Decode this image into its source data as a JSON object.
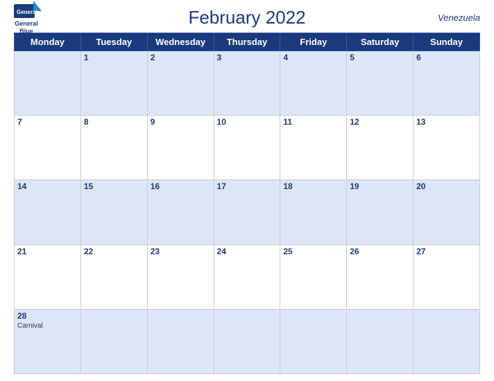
{
  "header": {
    "logo_line1": "General",
    "logo_line2": "Blue",
    "title": "February 2022",
    "country": "Venezuela"
  },
  "days_of_week": [
    "Monday",
    "Tuesday",
    "Wednesday",
    "Thursday",
    "Friday",
    "Saturday",
    "Sunday"
  ],
  "weeks": [
    [
      {
        "num": "",
        "event": ""
      },
      {
        "num": "1",
        "event": ""
      },
      {
        "num": "2",
        "event": ""
      },
      {
        "num": "3",
        "event": ""
      },
      {
        "num": "4",
        "event": ""
      },
      {
        "num": "5",
        "event": ""
      },
      {
        "num": "6",
        "event": ""
      }
    ],
    [
      {
        "num": "7",
        "event": ""
      },
      {
        "num": "8",
        "event": ""
      },
      {
        "num": "9",
        "event": ""
      },
      {
        "num": "10",
        "event": ""
      },
      {
        "num": "11",
        "event": ""
      },
      {
        "num": "12",
        "event": ""
      },
      {
        "num": "13",
        "event": ""
      }
    ],
    [
      {
        "num": "14",
        "event": ""
      },
      {
        "num": "15",
        "event": ""
      },
      {
        "num": "16",
        "event": ""
      },
      {
        "num": "17",
        "event": ""
      },
      {
        "num": "18",
        "event": ""
      },
      {
        "num": "19",
        "event": ""
      },
      {
        "num": "20",
        "event": ""
      }
    ],
    [
      {
        "num": "21",
        "event": ""
      },
      {
        "num": "22",
        "event": ""
      },
      {
        "num": "23",
        "event": ""
      },
      {
        "num": "24",
        "event": ""
      },
      {
        "num": "25",
        "event": ""
      },
      {
        "num": "26",
        "event": ""
      },
      {
        "num": "27",
        "event": ""
      }
    ],
    [
      {
        "num": "28",
        "event": "Carnival"
      },
      {
        "num": "",
        "event": ""
      },
      {
        "num": "",
        "event": ""
      },
      {
        "num": "",
        "event": ""
      },
      {
        "num": "",
        "event": ""
      },
      {
        "num": "",
        "event": ""
      },
      {
        "num": "",
        "event": ""
      }
    ]
  ],
  "blue_rows": [
    0,
    2,
    4
  ],
  "colors": {
    "header_bg": "#1a3a7c",
    "row_blue": "#dce6f7"
  }
}
